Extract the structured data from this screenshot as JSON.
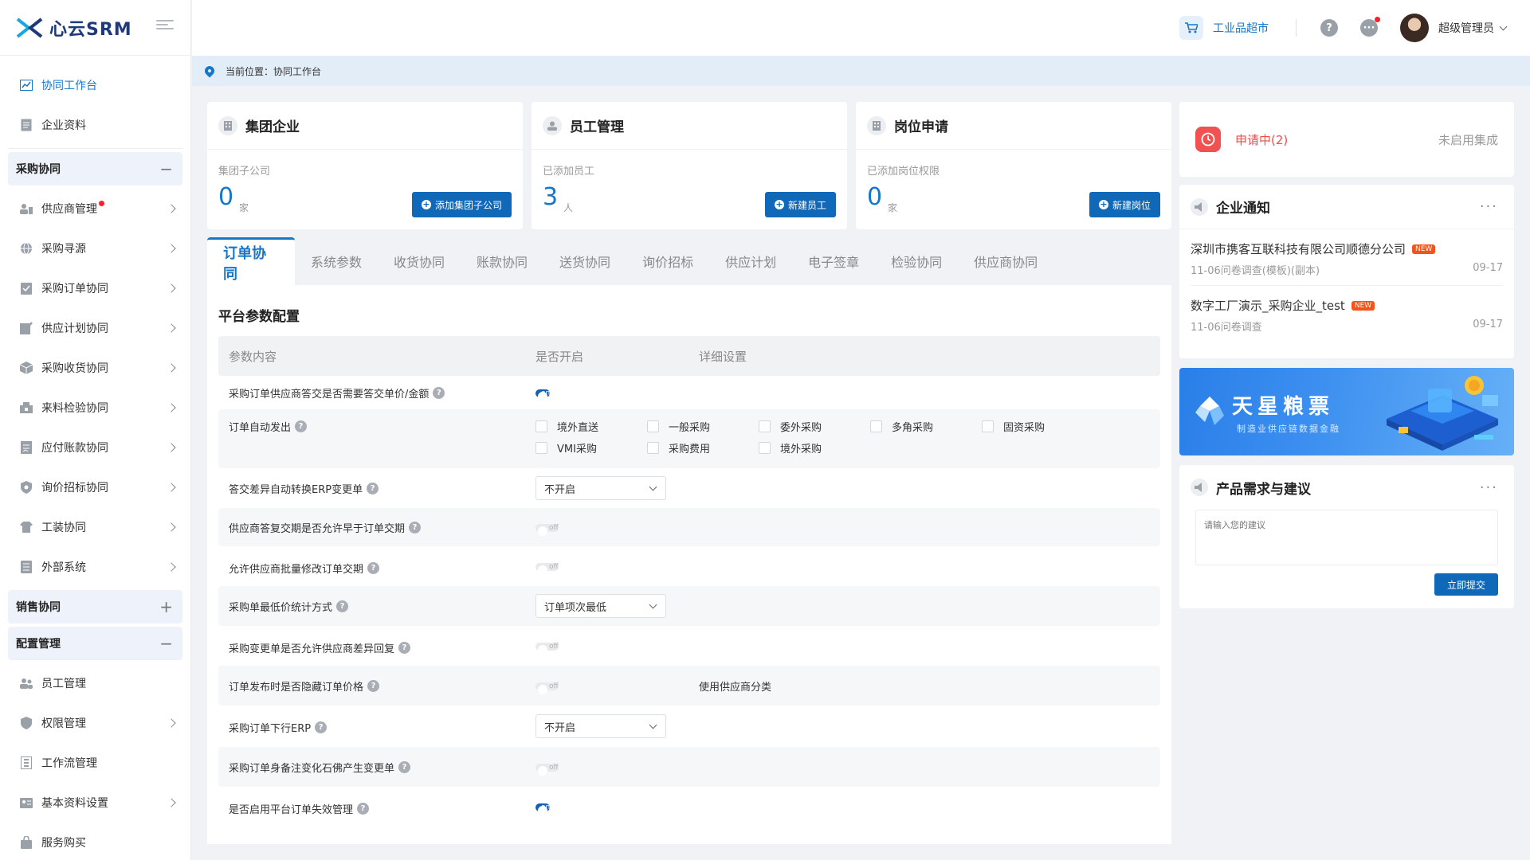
{
  "brand": {
    "name": "心云SRM"
  },
  "header": {
    "market_label": "工业品超市",
    "user_name": "超级管理员"
  },
  "breadcrumb": {
    "text": "当前位置：协同工作台"
  },
  "sidebar": {
    "top_items": [
      {
        "label": "协同工作台",
        "icon": "chart-icon",
        "active": true
      },
      {
        "label": "企业资料",
        "icon": "document-icon"
      }
    ],
    "group_purchase": {
      "label": "采购协同",
      "sign": "−"
    },
    "purchase_items": [
      {
        "label": "供应商管理",
        "icon": "supplier-icon",
        "badge": true
      },
      {
        "label": "采购寻源",
        "icon": "globe-icon"
      },
      {
        "label": "采购订单协同",
        "icon": "order-icon"
      },
      {
        "label": "供应计划协同",
        "icon": "plan-icon"
      },
      {
        "label": "采购收货协同",
        "icon": "box-icon"
      },
      {
        "label": "来料检验协同",
        "icon": "inspect-icon"
      },
      {
        "label": "应付账款协同",
        "icon": "bill-icon"
      },
      {
        "label": "询价招标协同",
        "icon": "shield-icon"
      },
      {
        "label": "工装协同",
        "icon": "shirt-icon"
      },
      {
        "label": "外部系统",
        "icon": "list-icon"
      }
    ],
    "group_sales": {
      "label": "销售协同",
      "sign": "+"
    },
    "group_config": {
      "label": "配置管理",
      "sign": "−"
    },
    "config_items": [
      {
        "label": "员工管理",
        "icon": "users-icon",
        "chevron": false
      },
      {
        "label": "权限管理",
        "icon": "shield-icon",
        "chevron": true
      },
      {
        "label": "工作流管理",
        "icon": "flow-icon",
        "chevron": false
      },
      {
        "label": "基本资料设置",
        "icon": "idcard-icon",
        "chevron": true
      },
      {
        "label": "服务购买",
        "icon": "bag-icon",
        "chevron": false
      }
    ]
  },
  "stats": [
    {
      "title": "集团企业",
      "sub": "集团子公司",
      "value": "0",
      "unit": "家",
      "button": "添加集团子公司",
      "icon": "building-icon"
    },
    {
      "title": "员工管理",
      "sub": "已添加员工",
      "value": "3",
      "unit": "人",
      "button": "新建员工",
      "icon": "user-icon"
    },
    {
      "title": "岗位申请",
      "sub": "已添加岗位权限",
      "value": "0",
      "unit": "家",
      "button": "新建岗位",
      "icon": "building-icon"
    }
  ],
  "tabs": [
    "订单协同",
    "系统参数",
    "收货协同",
    "账款协同",
    "送货协同",
    "询价招标",
    "供应计划",
    "电子签章",
    "检验协同",
    "供应商协同"
  ],
  "panel": {
    "title": "平台参数配置",
    "col_content": "参数内容",
    "col_enabled": "是否开启",
    "col_detail": "详细设置",
    "toggle_on": "on",
    "toggle_off": "off",
    "rows": [
      {
        "label": "采购订单供应商答交是否需要答交单价/金额",
        "type": "toggle",
        "value": "on"
      },
      {
        "label": "订单自动发出",
        "type": "checks",
        "options": [
          "境外直送",
          "一般采购",
          "委外采购",
          "多角采购",
          "固资采购",
          "VMI采购",
          "采购费用",
          "境外采购"
        ]
      },
      {
        "label": "答交差异自动转换ERP变更单",
        "type": "select",
        "value": "不开启"
      },
      {
        "label": "供应商答复交期是否允许早于订单交期",
        "type": "toggle",
        "value": "off"
      },
      {
        "label": "允许供应商批量修改订单交期",
        "type": "toggle",
        "value": "off"
      },
      {
        "label": "采购单最低价统计方式",
        "type": "select",
        "value": "订单项次最低"
      },
      {
        "label": "采购变更单是否允许供应商差异回复",
        "type": "toggle",
        "value": "off"
      },
      {
        "label": "订单发布时是否隐藏订单价格",
        "type": "toggle",
        "value": "off",
        "detail": "使用供应商分类"
      },
      {
        "label": "采购订单下行ERP",
        "type": "select",
        "value": "不开启"
      },
      {
        "label": "采购订单身备注变化石佛产生变更单",
        "type": "toggle",
        "value": "off"
      },
      {
        "label": "是否启用平台订单失效管理",
        "type": "toggle",
        "value": "on"
      }
    ]
  },
  "apply": {
    "label": "申请中(2)",
    "right": "未启用集成"
  },
  "notice": {
    "title": "企业通知",
    "more": "···",
    "new_tag": "NEW",
    "items": [
      {
        "title": "深圳市携客互联科技有限公司顺德分公司",
        "sub": "11-06问卷调查(模板)(副本)",
        "date": "09-17"
      },
      {
        "title": "数字工厂演示_采购企业_test",
        "sub": "11-06问卷调查",
        "date": "09-17"
      }
    ]
  },
  "banner": {
    "title": "天星粮票",
    "subtitle": "制造业供应链数据金融"
  },
  "feedback": {
    "title": "产品需求与建议",
    "more": "···",
    "placeholder": "请输入您的建议",
    "submit": "立即提交"
  },
  "colors": {
    "primary": "#1677c9",
    "button": "#1068b8",
    "danger": "#f04a4a",
    "new_tag": "#f2541b"
  }
}
